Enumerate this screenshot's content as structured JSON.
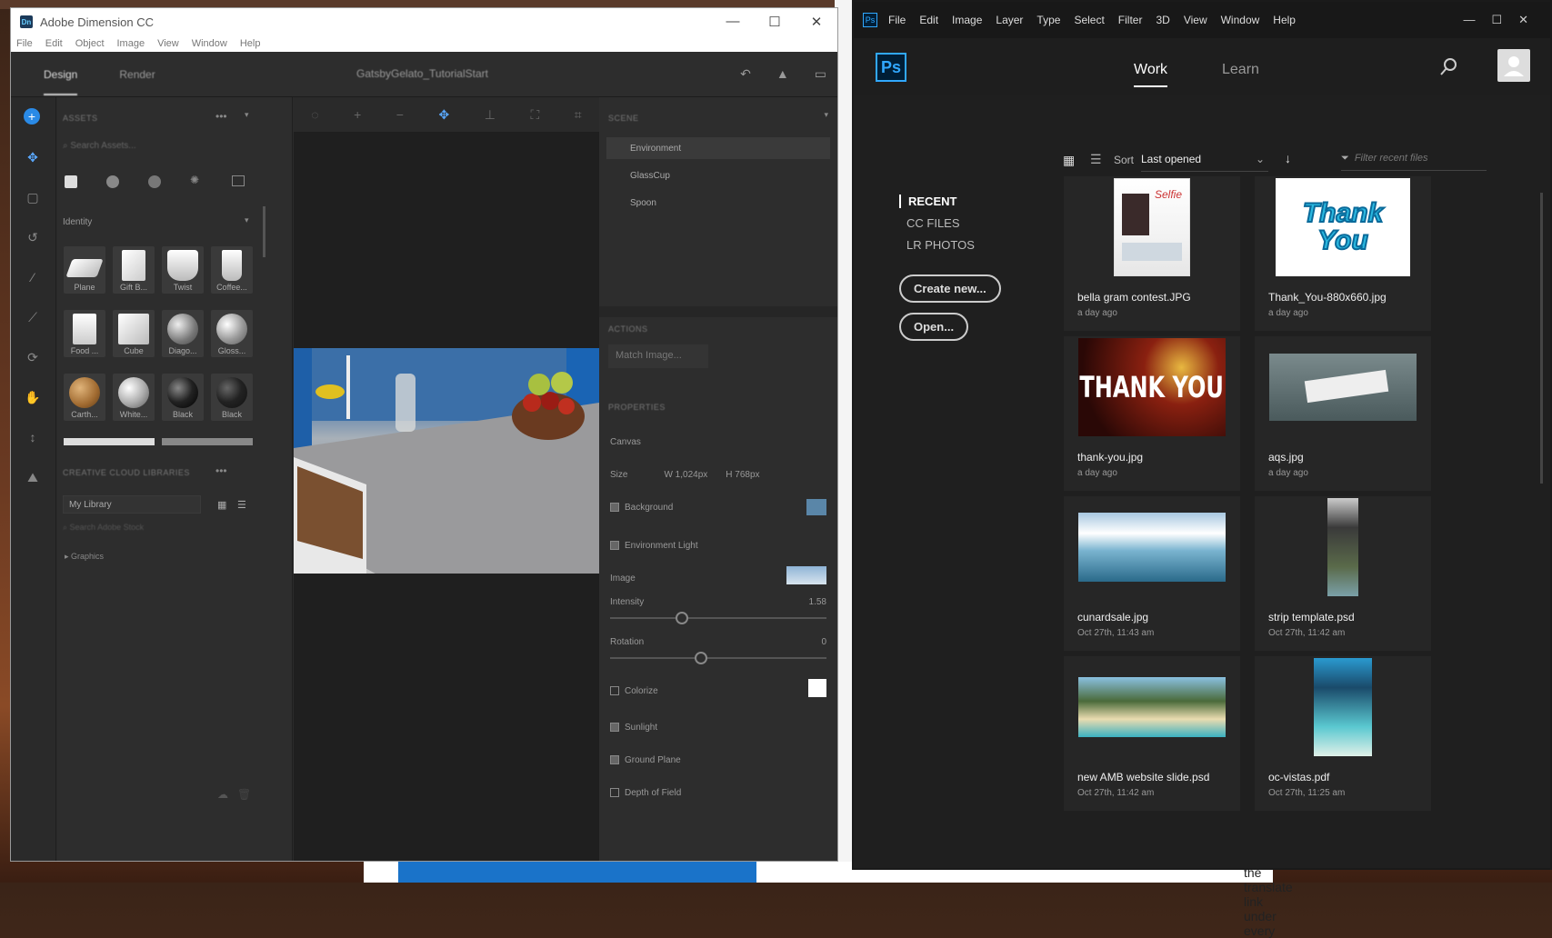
{
  "dimension": {
    "title": "Adobe Dimension CC",
    "menu": [
      "File",
      "Edit",
      "Object",
      "Image",
      "View",
      "Window",
      "Help"
    ],
    "tabs": [
      "Design",
      "Render"
    ],
    "doc_title": "GatsbyGelato_TutorialStart",
    "assets": {
      "header": "ASSETS",
      "search_placeholder": "Search Assets...",
      "category": "Identity",
      "items": [
        "Plane",
        "Gift B...",
        "Twist",
        "Coffee...",
        "Food ...",
        "Cube",
        "Diago...",
        "Gloss...",
        "Carth...",
        "White...",
        "Black",
        "Black"
      ],
      "libraries_header": "CREATIVE CLOUD LIBRARIES",
      "library": "My Library",
      "stock_placeholder": "Search Adobe Stock",
      "graphics": "Graphics"
    },
    "scene": {
      "header": "SCENE",
      "items": [
        "Environment",
        "GlassCup",
        "Spoon"
      ]
    },
    "actions": {
      "header": "ACTIONS",
      "match_image": "Match Image..."
    },
    "properties": {
      "header": "PROPERTIES",
      "canvas": "Canvas",
      "size_label": "Size",
      "width": "W  1,024px",
      "height": "H  768px",
      "background": "Background",
      "env_light": "Environment Light",
      "image_label": "Image",
      "intensity_label": "Intensity",
      "intensity_value": "1.58",
      "rotation_label": "Rotation",
      "rotation_value": "0",
      "colorize": "Colorize",
      "sunlight": "Sunlight",
      "ground_plane": "Ground Plane",
      "depth_of_field": "Depth of Field"
    }
  },
  "photoshop": {
    "menu": [
      "File",
      "Edit",
      "Image",
      "Layer",
      "Type",
      "Select",
      "Filter",
      "3D",
      "View",
      "Window",
      "Help"
    ],
    "logo": "Ps",
    "tabs": {
      "work": "Work",
      "learn": "Learn"
    },
    "sidebar": [
      "RECENT",
      "CC FILES",
      "LR PHOTOS"
    ],
    "create_btn": "Create new...",
    "open_btn": "Open...",
    "sort_label": "Sort",
    "sort_value": "Last opened",
    "filter_placeholder": "Filter recent files",
    "files": [
      {
        "name": "bella gram contest.JPG",
        "date": "a day ago"
      },
      {
        "name": "Thank_You-880x660.jpg",
        "date": "a day ago"
      },
      {
        "name": "thank-you.jpg",
        "date": "a day ago"
      },
      {
        "name": "aqs.jpg",
        "date": "a day ago"
      },
      {
        "name": "cunardsale.jpg",
        "date": "Oct 27th, 11:43 am"
      },
      {
        "name": "strip template.psd",
        "date": "Oct 27th, 11:42 am"
      },
      {
        "name": "new AMB website slide.psd",
        "date": "Oct 27th, 11:42 am"
      },
      {
        "name": "oc-vistas.pdf",
        "date": "Oct 27th, 11:25 am"
      }
    ],
    "thumb_text": {
      "thank_you_1": "Thank You",
      "thank_you_2": "THANK YOU"
    }
  },
  "background": {
    "caption": "the translate link under every"
  },
  "colors": {
    "ps_blue": "#31a8ff",
    "dn_blue": "#2a8ae6"
  }
}
